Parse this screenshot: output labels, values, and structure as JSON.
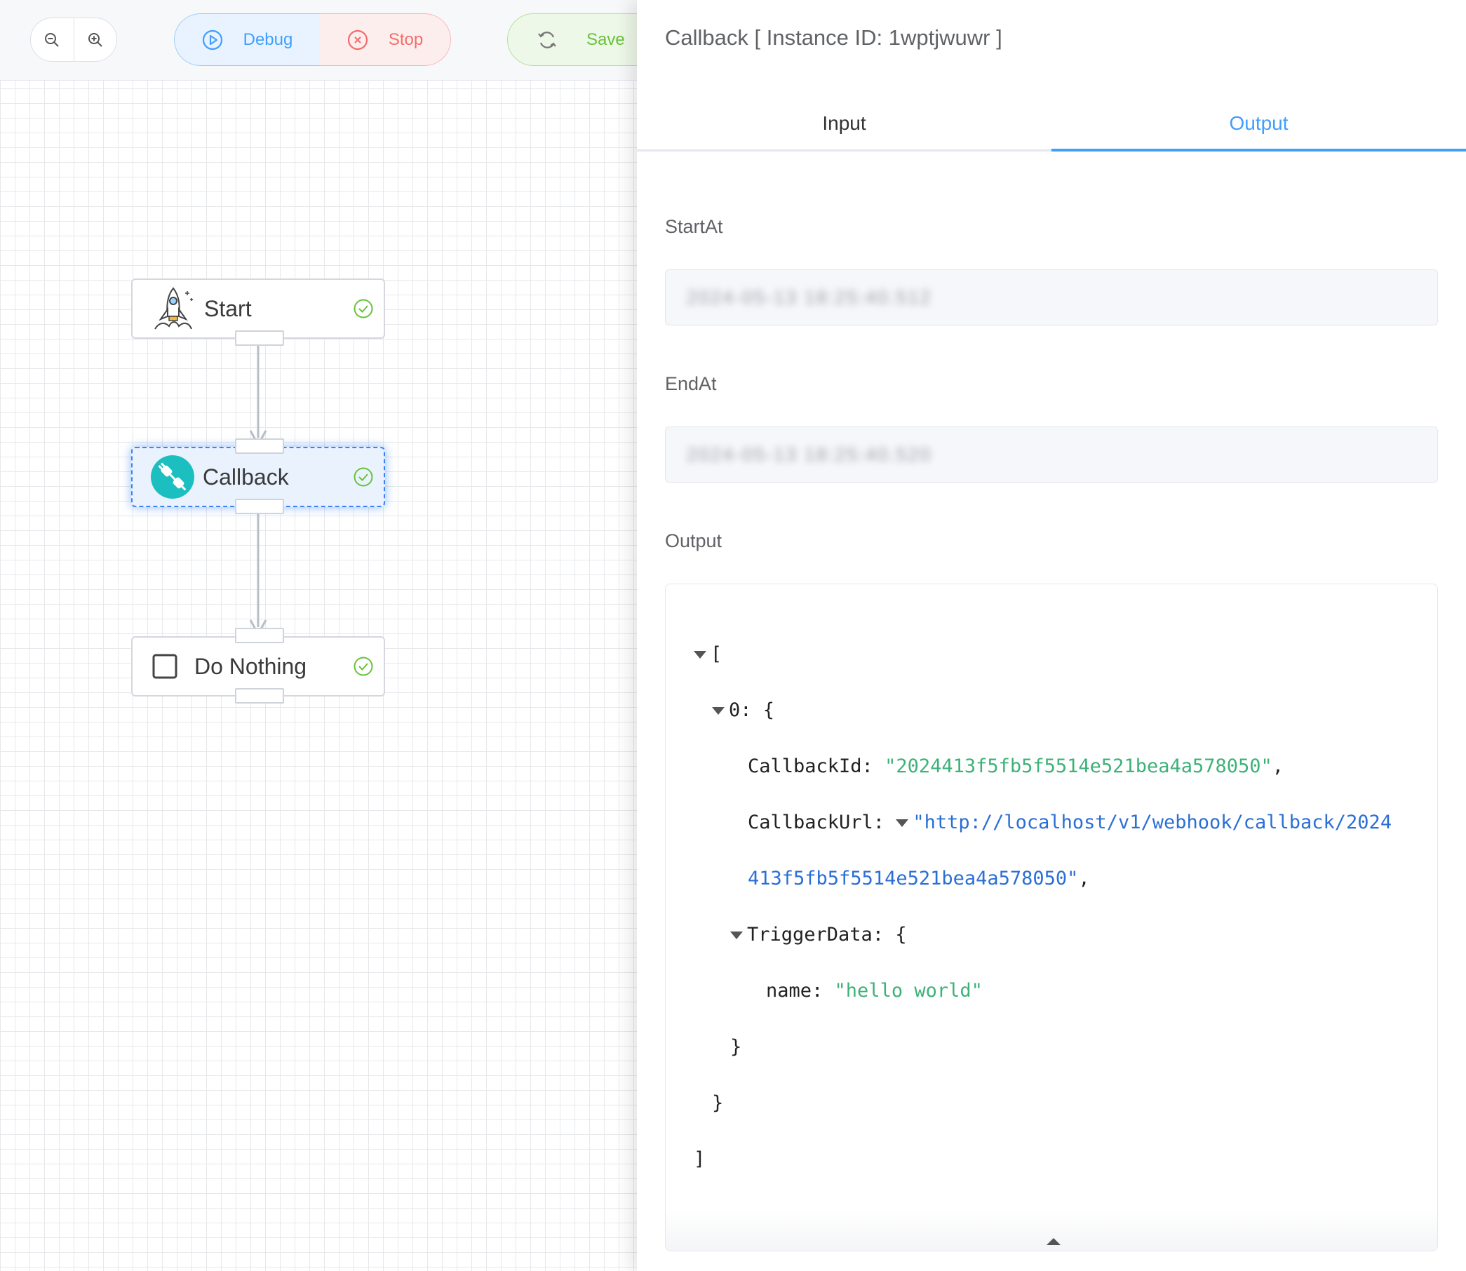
{
  "toolbar": {
    "debug_label": "Debug",
    "stop_label": "Stop",
    "save_label": "Save",
    "zoom_out_icon": "zoom-out-icon",
    "zoom_in_icon": "zoom-in-icon"
  },
  "flow": {
    "nodes": [
      {
        "label": "Start",
        "icon": "rocket-icon",
        "status": "success"
      },
      {
        "label": "Callback",
        "icon": "plug-icon",
        "status": "success",
        "selected": true
      },
      {
        "label": "Do Nothing",
        "icon": "checkbox-icon",
        "status": "success"
      }
    ]
  },
  "panel": {
    "title": "Callback [ Instance ID: 1wptjwuwr ]",
    "tabs": [
      {
        "label": "Input",
        "active": false
      },
      {
        "label": "Output",
        "active": true
      }
    ],
    "fields": {
      "start_label": "StartAt",
      "start_value": "2024-05-13 18:25:40.512",
      "end_label": "EndAt",
      "end_value": "2024-05-13 18:25:40.520",
      "output_label": "Output"
    },
    "output_json": {
      "open_bracket": "[",
      "index": "0:",
      "open_brace": "{",
      "callback_id_key": "CallbackId:",
      "callback_id_value": "\"2024413f5fb5f5514e521bea4a578050\"",
      "callback_url_key": "CallbackUrl:",
      "callback_url_line1": "\"http://localhost/v1/webhook/callback/2024",
      "callback_url_line2": "413f5fb5f5514e521bea4a578050\"",
      "trigger_key": "TriggerData:",
      "name_key": "name:",
      "name_value": "\"hello world\"",
      "close_inner_brace": "}",
      "close_brace": "}",
      "close_bracket": "]",
      "comma": ","
    }
  },
  "colors": {
    "primary": "#409eff",
    "danger": "#f56c6c",
    "success": "#67c23a",
    "json_string": "#3db278",
    "json_url": "#2a6fd6"
  }
}
